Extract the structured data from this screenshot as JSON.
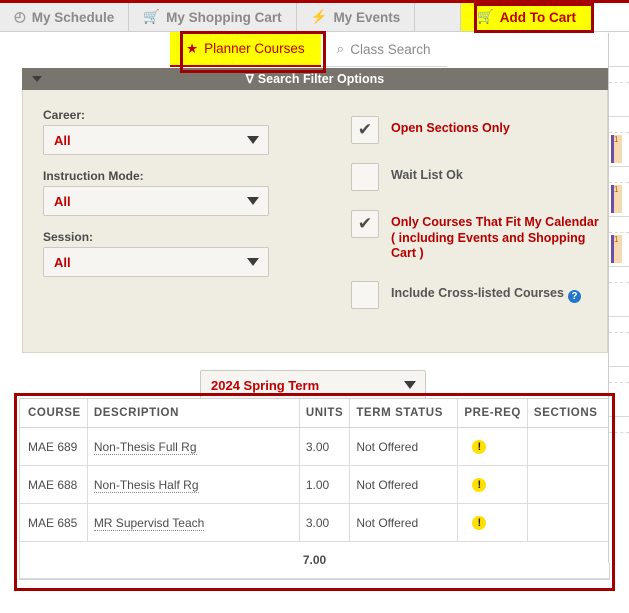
{
  "tabs": [
    {
      "label": "My Schedule",
      "icon": "clock-icon",
      "glyph": "◴",
      "state": "inactive"
    },
    {
      "label": "My Shopping Cart",
      "icon": "cart-icon",
      "glyph": "🛒",
      "state": "inactive"
    },
    {
      "label": "My Events",
      "icon": "lightning-icon",
      "glyph": "⚡",
      "state": "inactive"
    },
    {
      "label": "Add To Cart",
      "icon": "cart-add-icon",
      "glyph": "🛒",
      "state": "highlighted"
    }
  ],
  "subtabs": [
    {
      "label": "Planner Courses",
      "icon": "star-icon",
      "glyph": "★",
      "state": "active"
    },
    {
      "label": "Class Search",
      "icon": "search-icon",
      "glyph": "⌕",
      "state": "inactive"
    }
  ],
  "filter_panel": {
    "header": "Search Filter Options",
    "header_icon": "funnel-icon",
    "header_glyph": "∇",
    "collapse_icon": "caret-down-icon",
    "fields": [
      {
        "label": "Career:",
        "value": "All"
      },
      {
        "label": "Instruction Mode:",
        "value": "All"
      },
      {
        "label": "Session:",
        "value": "All"
      }
    ],
    "checkboxes": [
      {
        "label": "Open Sections Only",
        "checked": true,
        "color": "red",
        "glyph": "✔"
      },
      {
        "label": "Wait List Ok",
        "checked": false,
        "color": "gray",
        "glyph": ""
      },
      {
        "label": "Only Courses That Fit My Calendar",
        "label2": "( including Events and Shopping Cart )",
        "checked": true,
        "color": "red",
        "glyph": "✔"
      },
      {
        "label": "Include Cross-listed Courses",
        "checked": false,
        "color": "gray",
        "glyph": "",
        "help": "?"
      }
    ]
  },
  "term_select": {
    "value": "2024 Spring Term"
  },
  "table": {
    "columns": [
      "COURSE",
      "DESCRIPTION",
      "UNITS",
      "TERM STATUS",
      "PRE-REQ",
      "SECTIONS"
    ],
    "rows": [
      {
        "course": "MAE 689",
        "description": "Non-Thesis Full Rg",
        "units": "3.00",
        "term_status": "Not Offered",
        "prereq": "!",
        "sections": ""
      },
      {
        "course": "MAE 688",
        "description": "Non-Thesis Half Rg",
        "units": "1.00",
        "term_status": "Not Offered",
        "prereq": "!",
        "sections": ""
      },
      {
        "course": "MAE 685",
        "description": "MR Supervisd Teach",
        "units": "3.00",
        "term_status": "Not Offered",
        "prereq": "!",
        "sections": ""
      }
    ],
    "total_units": "7.00"
  },
  "calendar_sliver": {
    "events": [
      "1",
      "1",
      "1"
    ]
  },
  "colors": {
    "accent_red": "#c00000",
    "highlight_yellow": "#ffff00",
    "panel_beige": "#efede1",
    "header_gray": "#78756f",
    "warn_yellow": "#ffe000",
    "help_blue": "#2277cc"
  }
}
